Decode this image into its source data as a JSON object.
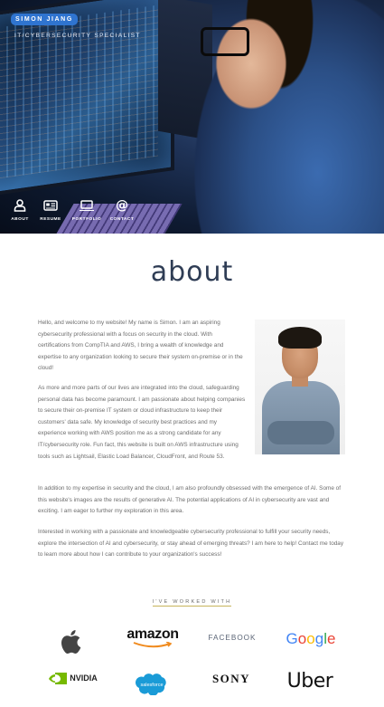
{
  "header": {
    "name": "SIMON JIANG",
    "subtitle": "IT/CYBERSECURITY SPECIALIST"
  },
  "nav": {
    "items": [
      {
        "label": "ABOUT",
        "icon": "person-icon"
      },
      {
        "label": "RESUME",
        "icon": "id-card-icon"
      },
      {
        "label": "PORTFOLIO",
        "icon": "laptop-icon"
      },
      {
        "label": "CONTACT",
        "icon": "at-icon"
      }
    ]
  },
  "about": {
    "title": "about",
    "p1": "Hello, and welcome to my website! My name is Simon. I am an aspiring cybersecurity professional with a focus on security in the cloud. With certifications from CompTIA and AWS, I bring a wealth of knowledge and expertise to any organization looking to secure their system on-premise or in the cloud!",
    "p2": "As more and more parts of our lives are integrated into the cloud, safeguarding personal data has become paramount. I am passionate about helping companies to secure their on-premise IT system or cloud infrastructure to keep their customers' data safe. My knowledge of security best practices and my experience working with AWS position me as a strong candidate for any IT/cybersecurity role. Fun fact, this website is built on AWS infrastructure using tools such as Lightsail, Elastic Load Balancer, CloudFront, and Route 53.",
    "p3": "In addition to my expertise in security and the cloud, I am also profoundly obsessed with the emergence of AI. Some of this website's images are the results of generative AI. The potential applications of AI in cybersecurity are vast and exciting. I am eager to further my exploration in this area.",
    "p4": "Interested in working with a passionate and knowledgeable cybersecurity professional to fulfill your security needs, explore the intersection of AI and cybersecurity, or stay ahead of emerging threats? I am here to help! Contact me today to learn more about how I can contribute to your organization's success!"
  },
  "partners": {
    "heading": "I'VE WORKED WITH",
    "logos": {
      "apple": "apple-logo",
      "amazon": "amazon",
      "facebook": "FACEBOOK",
      "google": "Google",
      "nvidia": "NVIDIA",
      "salesforce": "salesforce",
      "sony": "SONY",
      "uber": "Uber"
    }
  },
  "colors": {
    "accent": "#2f74d0",
    "title": "#2f3d55",
    "underline": "#c7b45b"
  }
}
